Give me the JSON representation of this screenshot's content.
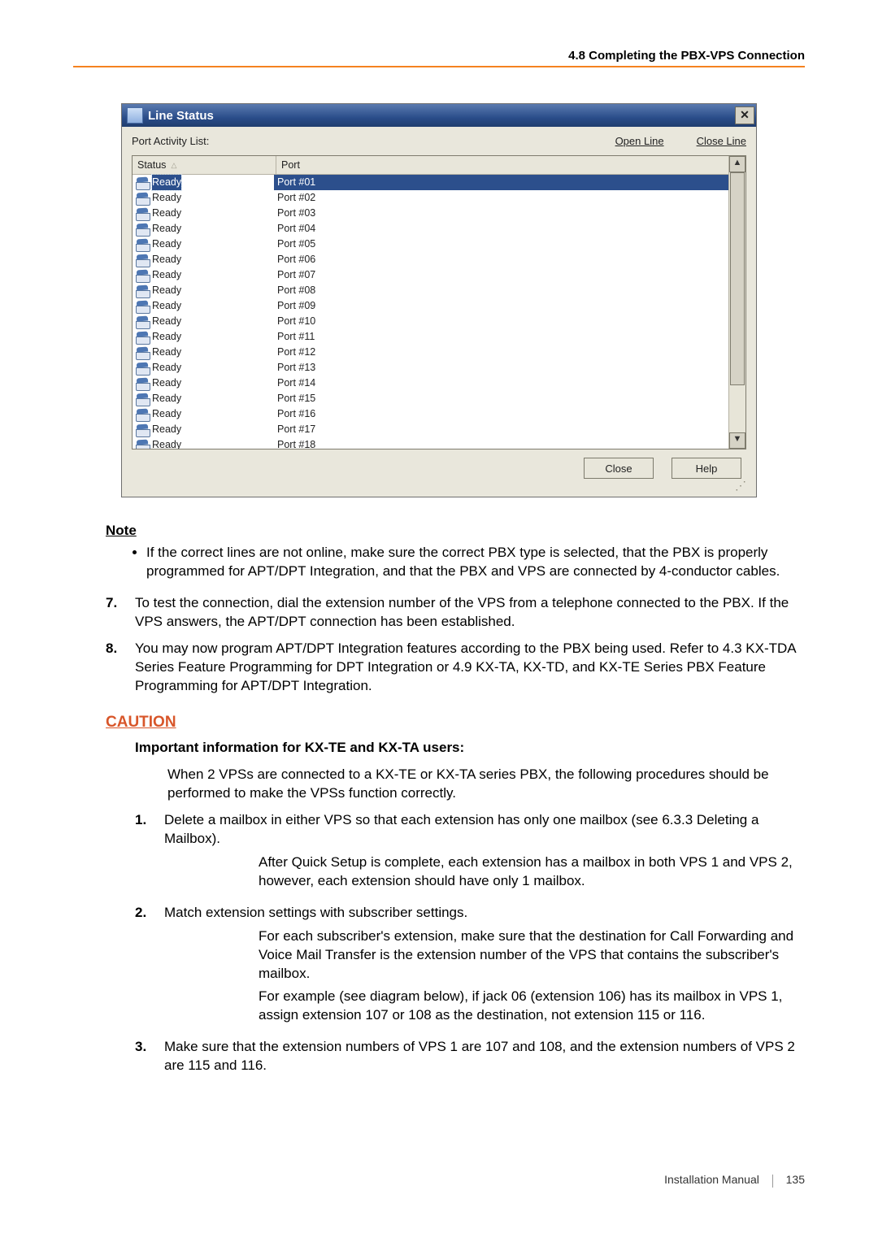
{
  "page_header": "4.8 Completing the PBX-VPS Connection",
  "dialog": {
    "title": "Line Status",
    "list_label": "Port Activity List:",
    "open_line": "Open Line",
    "close_line": "Close Line",
    "col_status": "Status",
    "col_port": "Port",
    "rows": [
      {
        "status": "Ready",
        "port": "Port #01"
      },
      {
        "status": "Ready",
        "port": "Port #02"
      },
      {
        "status": "Ready",
        "port": "Port #03"
      },
      {
        "status": "Ready",
        "port": "Port #04"
      },
      {
        "status": "Ready",
        "port": "Port #05"
      },
      {
        "status": "Ready",
        "port": "Port #06"
      },
      {
        "status": "Ready",
        "port": "Port #07"
      },
      {
        "status": "Ready",
        "port": "Port #08"
      },
      {
        "status": "Ready",
        "port": "Port #09"
      },
      {
        "status": "Ready",
        "port": "Port #10"
      },
      {
        "status": "Ready",
        "port": "Port #11"
      },
      {
        "status": "Ready",
        "port": "Port #12"
      },
      {
        "status": "Ready",
        "port": "Port #13"
      },
      {
        "status": "Ready",
        "port": "Port #14"
      },
      {
        "status": "Ready",
        "port": "Port #15"
      },
      {
        "status": "Ready",
        "port": "Port #16"
      },
      {
        "status": "Ready",
        "port": "Port #17"
      },
      {
        "status": "Ready",
        "port": "Port #18"
      }
    ],
    "close_btn": "Close",
    "help_btn": "Help"
  },
  "note": {
    "heading": "Note",
    "bullet": "If the correct lines are not online, make sure the correct PBX type is selected, that the PBX is properly programmed for APT/DPT Integration, and that the PBX and VPS are connected by 4-conductor cables."
  },
  "steps_top": [
    {
      "num": "7.",
      "text": "To test the connection, dial the extension number of the VPS from a telephone connected to the PBX. If the VPS answers, the APT/DPT connection has been established."
    },
    {
      "num": "8.",
      "text": "You may now program APT/DPT Integration features according to the PBX being used. Refer to 4.3 KX-TDA Series Feature Programming for DPT Integration or 4.9 KX-TA, KX-TD, and KX-TE Series PBX Feature Programming for APT/DPT Integration."
    }
  ],
  "caution": {
    "heading": "CAUTION",
    "subheading": "Important information for KX-TE and KX-TA users:",
    "intro": "When 2 VPSs are connected to a KX-TE or KX-TA series PBX, the following procedures should be performed to make the VPSs function correctly.",
    "items": [
      {
        "num": "1.",
        "lead": "Delete a mailbox in either VPS so that each extension has only one mailbox (see 6.3.3 Deleting a Mailbox).",
        "sub": [
          "After Quick Setup is complete, each extension has a mailbox in both VPS 1 and VPS 2, however, each extension should have only 1 mailbox."
        ]
      },
      {
        "num": "2.",
        "lead": "Match extension settings with subscriber settings.",
        "sub": [
          "For each subscriber's extension, make sure that the destination for Call Forwarding and Voice Mail Transfer is the extension number of the VPS that contains the subscriber's mailbox.",
          "For example (see diagram below), if jack 06 (extension 106) has its mailbox in VPS 1, assign extension 107 or 108 as the destination, not extension 115 or 116."
        ]
      },
      {
        "num": "3.",
        "lead": "Make sure that the extension numbers of VPS 1 are 107 and 108, and the extension numbers of VPS 2 are 115 and 116.",
        "sub": []
      }
    ]
  },
  "footer": {
    "manual": "Installation Manual",
    "page": "135"
  }
}
